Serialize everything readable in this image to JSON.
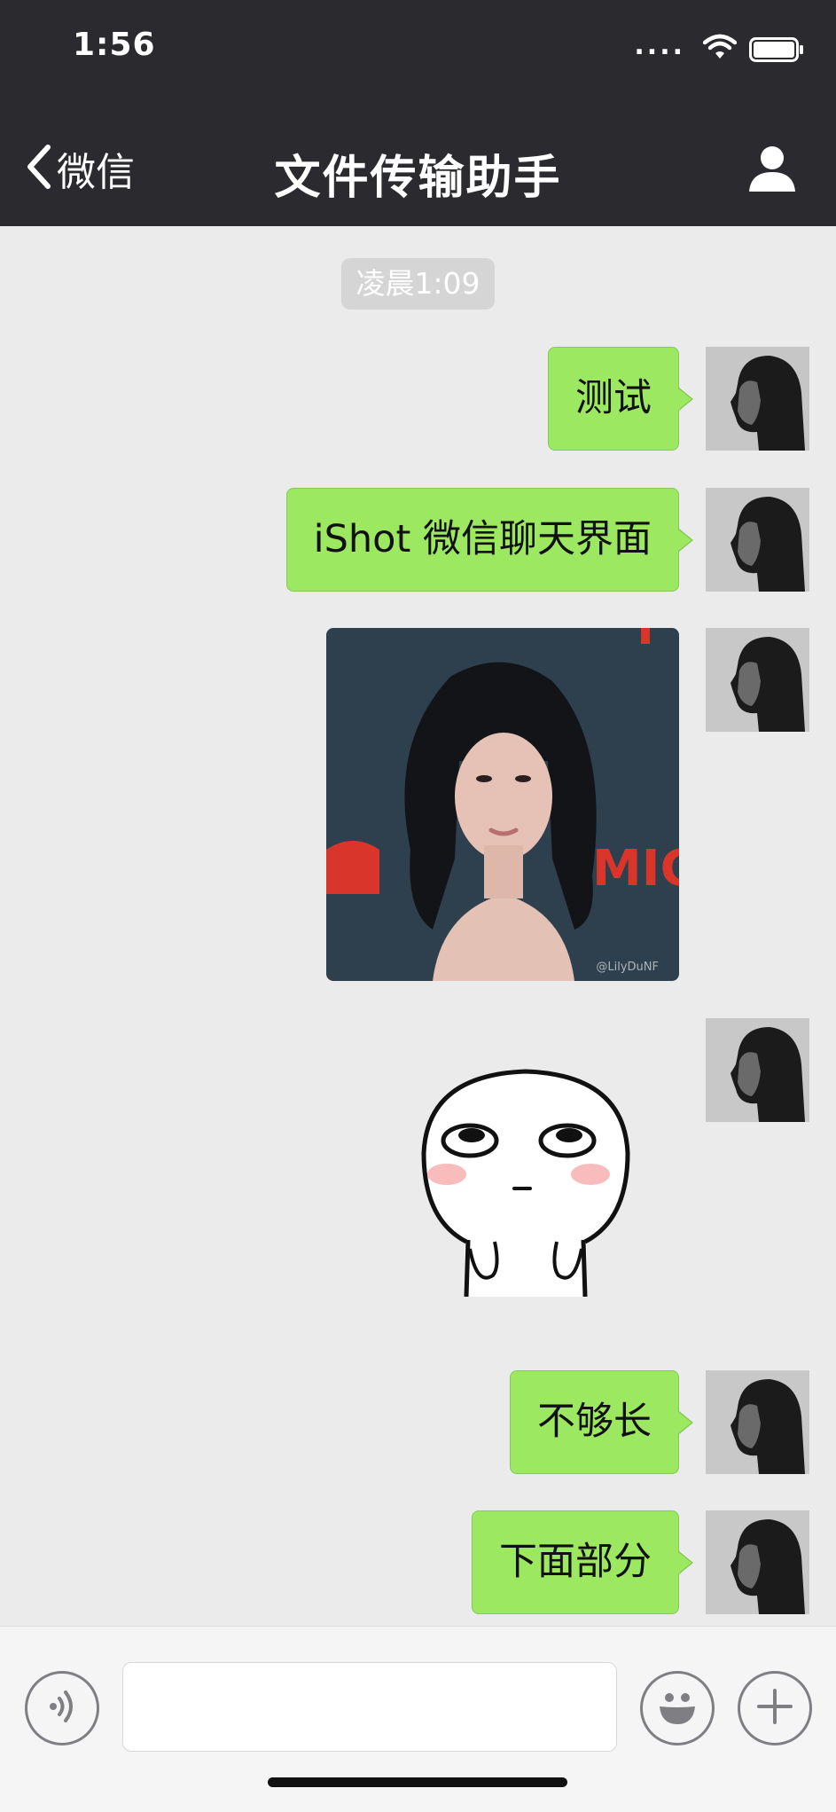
{
  "status_bar": {
    "time": "1:56",
    "signal": "...."
  },
  "nav": {
    "back_label": "微信",
    "title": "文件传输助手"
  },
  "chat": {
    "timestamp": "凌晨1:09",
    "messages": [
      {
        "type": "text",
        "text": "测试"
      },
      {
        "type": "text",
        "text": "iShot 微信聊天界面"
      },
      {
        "type": "image",
        "watermark": "@LilyDuNF"
      },
      {
        "type": "sticker"
      },
      {
        "type": "text",
        "text": "不够长"
      },
      {
        "type": "text",
        "text": "下面部分"
      }
    ]
  },
  "input_bar": {
    "message_value": ""
  },
  "colors": {
    "nav_background": "#2b2b2f",
    "chat_background": "#ebebeb",
    "bubble_sent": "#9de861",
    "timestamp_background": "#d5d5d5"
  },
  "icons": [
    "back-chevron-icon",
    "wifi-icon",
    "battery-icon",
    "profile-icon",
    "voice-icon",
    "emoji-icon",
    "plus-icon"
  ]
}
